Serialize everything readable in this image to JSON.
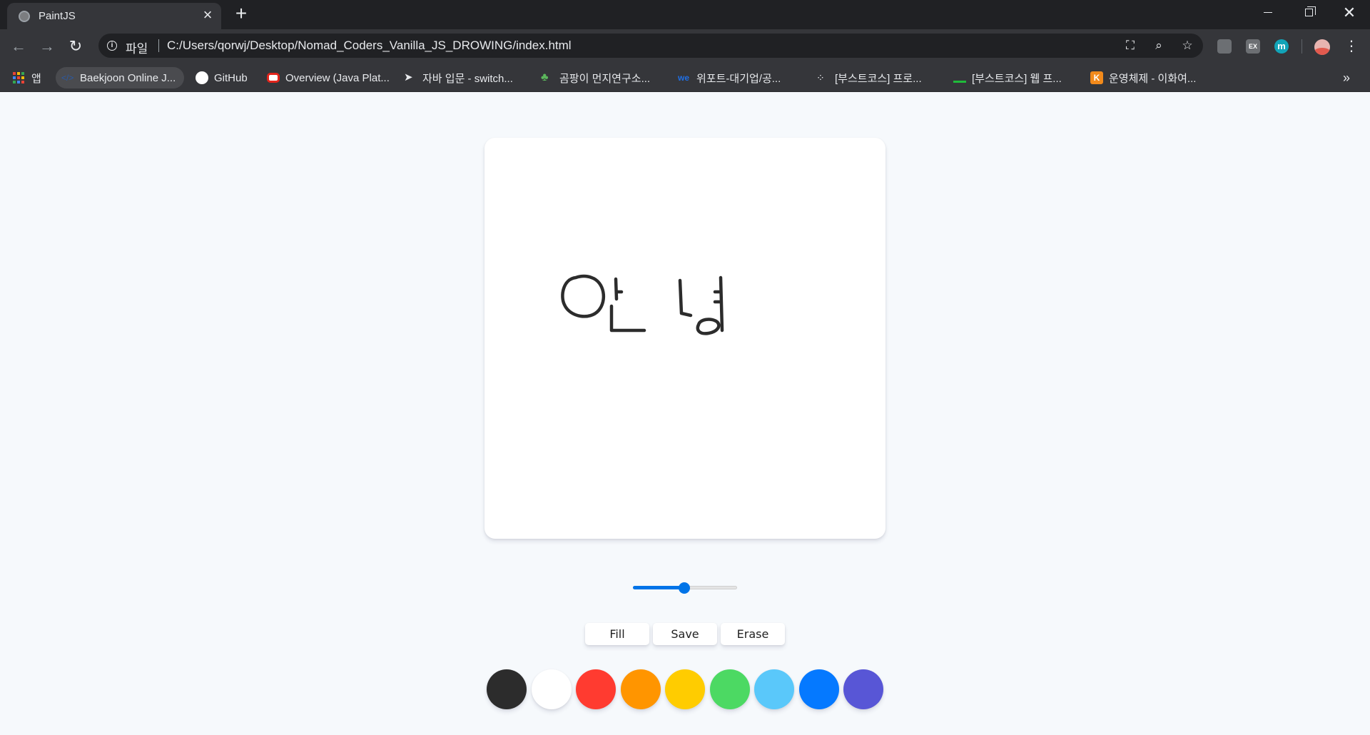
{
  "browser": {
    "tab": {
      "title": "PaintJS",
      "close_glyph": "×"
    },
    "new_tab_glyph": "+",
    "window": {
      "minimize": "",
      "maximize": "",
      "close": "✕"
    },
    "nav": {
      "back": "←",
      "forward": "→",
      "reload": "↻"
    },
    "address": {
      "info": "i",
      "label": "파일",
      "url": "C:/Users/qorwj/Desktop/Nomad_Coders_Vanilla_JS_DROWING/index.html"
    },
    "omnibox_icons": {
      "translate": "⛶",
      "zoom": "⌕",
      "star": "☆"
    },
    "extensions": {
      "ext1": "",
      "ext2": "EX",
      "ext3": "m"
    },
    "menu_glyph": "⋮"
  },
  "bookmarks": {
    "apps": "앱",
    "items": [
      {
        "label": "Baekjoon Online J...",
        "icon": "baekjoon-icon",
        "color": "#2a5aa6"
      },
      {
        "label": "GitHub",
        "icon": "github-icon",
        "color": "#ffffff"
      },
      {
        "label": "Overview (Java Plat...",
        "icon": "oracle-icon",
        "color": "#e2241b"
      },
      {
        "label": "자바 입문 - switch...",
        "icon": "bird-icon",
        "color": "#5b8fd8"
      },
      {
        "label": "곰팡이 먼지연구소...",
        "icon": "clover-icon",
        "color": "#5cb85c"
      },
      {
        "label": "위포트-대기업/공...",
        "icon": "wepot-icon",
        "color": "#1f4fb5"
      },
      {
        "label": "[부스트코스] 프로...",
        "icon": "boostcourse-icon",
        "color": "#202124"
      },
      {
        "label": "[부스트코스] 웹 프...",
        "icon": "boostcourse-green-icon",
        "color": "#1fbb3a"
      },
      {
        "label": "운영체제 - 이화여...",
        "icon": "kocw-icon",
        "color": "#f28a1b"
      }
    ],
    "more": "»"
  },
  "paint": {
    "brush_range": {
      "min": 0.1,
      "max": 5,
      "value": 2.5
    },
    "buttons": {
      "fill": "Fill",
      "save": "Save",
      "erase": "Erase"
    },
    "palette": [
      {
        "name": "black",
        "color": "#2c2c2c"
      },
      {
        "name": "white",
        "color": "#ffffff"
      },
      {
        "name": "red",
        "color": "#ff3b30"
      },
      {
        "name": "orange",
        "color": "#ff9500"
      },
      {
        "name": "yellow",
        "color": "#ffcc00"
      },
      {
        "name": "green",
        "color": "#4cd963"
      },
      {
        "name": "sky-blue",
        "color": "#5ac8fa"
      },
      {
        "name": "blue",
        "color": "#0579ff"
      },
      {
        "name": "purple",
        "color": "#5856d6"
      }
    ],
    "stroke_color": "#2c2c2c"
  }
}
